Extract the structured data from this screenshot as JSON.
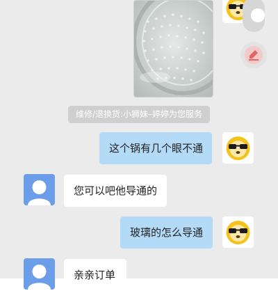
{
  "messages": [
    {
      "type": "image",
      "sender": "agent"
    },
    {
      "type": "system",
      "text": "维修/退换货:小狮妹–婷婷为您服务"
    },
    {
      "type": "text",
      "sender": "agent",
      "text": "这个锅有几个眼不通"
    },
    {
      "type": "text",
      "sender": "user",
      "text": "您可以吧他导通的"
    },
    {
      "type": "text",
      "sender": "agent",
      "text": "玻璃的怎么导通"
    },
    {
      "type": "text",
      "sender": "user",
      "text": "亲亲订单"
    }
  ],
  "colors": {
    "background": "#ebebeb",
    "outgoing_bubble": "#b3dbf7",
    "incoming_bubble": "#ffffff",
    "user_avatar": "#6b9de8",
    "system_note": "#cfcfcf",
    "action_accent": "#e06666"
  },
  "icons": {
    "agent_avatar": "sunglasses-lion-icon",
    "user_avatar": "default-person-icon",
    "float_action": "edit-icon"
  }
}
